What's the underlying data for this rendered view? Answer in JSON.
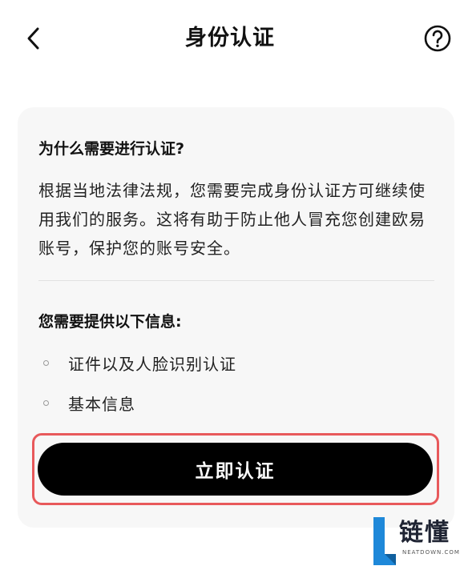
{
  "header": {
    "title": "身份认证",
    "back_icon": "chevron-left-icon",
    "help_icon": "question-circle-icon"
  },
  "card": {
    "question_heading": "为什么需要进行认证?",
    "body_text": "根据当地法律法规，您需要完成身份认证方可继续使用我们的服务。这将有助于防止他人冒充您创建欧易账号，保护您的账号安全。",
    "requirements_heading": "您需要提供以下信息:",
    "requirements": [
      "证件以及人脸识别认证",
      "基本信息"
    ],
    "cta_label": "立即认证"
  },
  "watermark": {
    "brand_text": "链懂",
    "domain": "NEATDOWN.COM"
  },
  "colors": {
    "cta_background": "#000000",
    "highlight_border": "#e8595b",
    "card_background": "#f7f7f7",
    "watermark_blue": "#1e88d9"
  }
}
